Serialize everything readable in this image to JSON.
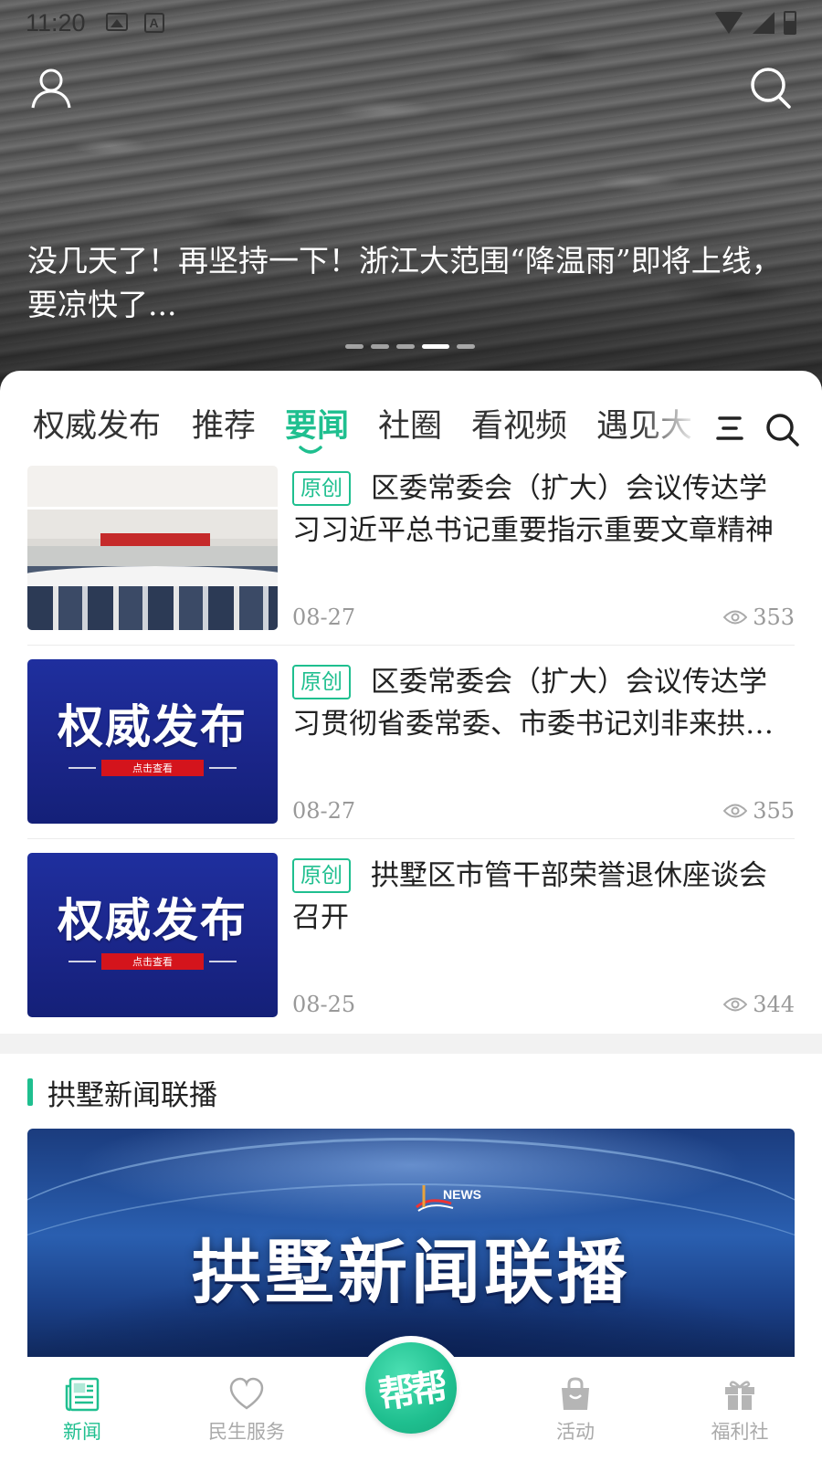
{
  "status_bar": {
    "time": "11:20",
    "icons": [
      "image-icon",
      "font-icon",
      "wifi-icon",
      "signal-icon",
      "battery-icon"
    ]
  },
  "hero": {
    "headline": "没几天了！再坚持一下！浙江大范围“降温雨”即将上线，要凉快了...",
    "carousel_count": 5,
    "carousel_active_index": 3,
    "icons": [
      "user-icon",
      "search-icon"
    ]
  },
  "tabs": {
    "items": [
      "权威发布",
      "推荐",
      "要闻",
      "社圈",
      "看视频",
      "遇见大"
    ],
    "active": "要闻",
    "icons": [
      "menu-icon",
      "search-icon"
    ]
  },
  "news": [
    {
      "tag": "原创",
      "title": "区委常委会（扩大）会议传达学习习近平总书记重要指示重要文章精神",
      "date": "08-27",
      "views": "353",
      "thumb": "meeting"
    },
    {
      "tag": "原创",
      "title": "区委常委会（扩大）会议传达学习贯彻省委常委、市委书记刘非来拱墅调研时讲话精神",
      "date": "08-27",
      "views": "355",
      "thumb": "authority",
      "thumb_text": "权威发布",
      "thumb_button": "点击查看"
    },
    {
      "tag": "原创",
      "title": "拱墅区市管干部荣誉退休座谈会召开",
      "date": "08-25",
      "views": "344",
      "thumb": "authority",
      "thumb_text": "权威发布",
      "thumb_button": "点击查看"
    }
  ],
  "section": {
    "title": "拱墅新闻联播",
    "banner_title": "拱墅新闻联播",
    "banner_logo": "NEWS"
  },
  "bottom_nav": {
    "items": [
      {
        "label": "新闻",
        "icon": "newspaper-icon",
        "active": true
      },
      {
        "label": "民生服务",
        "icon": "heart-icon",
        "active": false
      },
      {
        "label": "活动",
        "icon": "bag-icon",
        "active": false
      },
      {
        "label": "福利社",
        "icon": "gift-icon",
        "active": false
      }
    ],
    "center_label": "帮帮"
  },
  "colors": {
    "accent": "#1fbf8f",
    "text": "#222222",
    "muted": "#999999",
    "nav_inactive": "#aaaaaa"
  }
}
